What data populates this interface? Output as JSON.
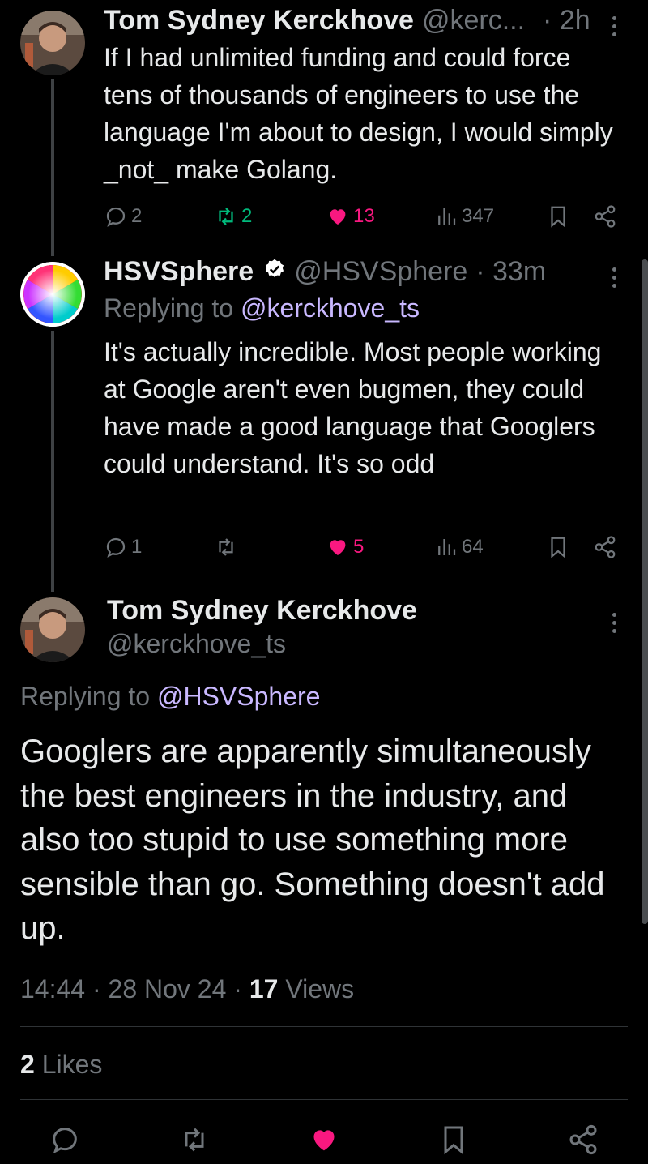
{
  "tweet1": {
    "display_name": "Tom Sydney Kerckhove",
    "handle": "@kerc...",
    "time": "· 2h",
    "text": "If I had unlimited funding and could force tens of thousands of engineers to use the language I'm about to design, I would simply _not_ make Golang.",
    "replies": "2",
    "retweets": "2",
    "likes": "13",
    "views": "347"
  },
  "tweet2": {
    "display_name": "HSVSphere",
    "handle": "@HSVSphere",
    "time": "· 33m",
    "replying_prefix": "Replying to ",
    "replying_handle": "@kerckhove_ts",
    "text": "It's actually incredible. Most people working at Google aren't even bugmen, they could have made a good language that Googlers could understand. It's so odd",
    "replies": "1",
    "retweets": "",
    "likes": "5",
    "views": "64"
  },
  "main": {
    "display_name": "Tom Sydney Kerckhove",
    "handle": "@kerckhove_ts",
    "replying_prefix": "Replying to ",
    "replying_handle": "@HSVSphere",
    "text": "Googlers are apparently simultaneously the best engineers in the industry, and also too stupid to use something more sensible than go. Something doesn't add up.",
    "timestamp": "14:44 · 28 Nov 24 · ",
    "views_count": "17",
    "views_label": " Views",
    "likes_count": "2",
    "likes_label": " Likes"
  },
  "colors": {
    "background": "#000000",
    "text": "#e7e9ea",
    "muted": "#71767b",
    "link": "#c9b8ff",
    "retweet_green": "#00ba7c",
    "like_pink": "#f91880",
    "verified": "#ffffff"
  },
  "icons": [
    "reply-icon",
    "retweet-icon",
    "heart-icon",
    "views-icon",
    "bookmark-icon",
    "share-icon",
    "more-icon",
    "verified-icon"
  ]
}
